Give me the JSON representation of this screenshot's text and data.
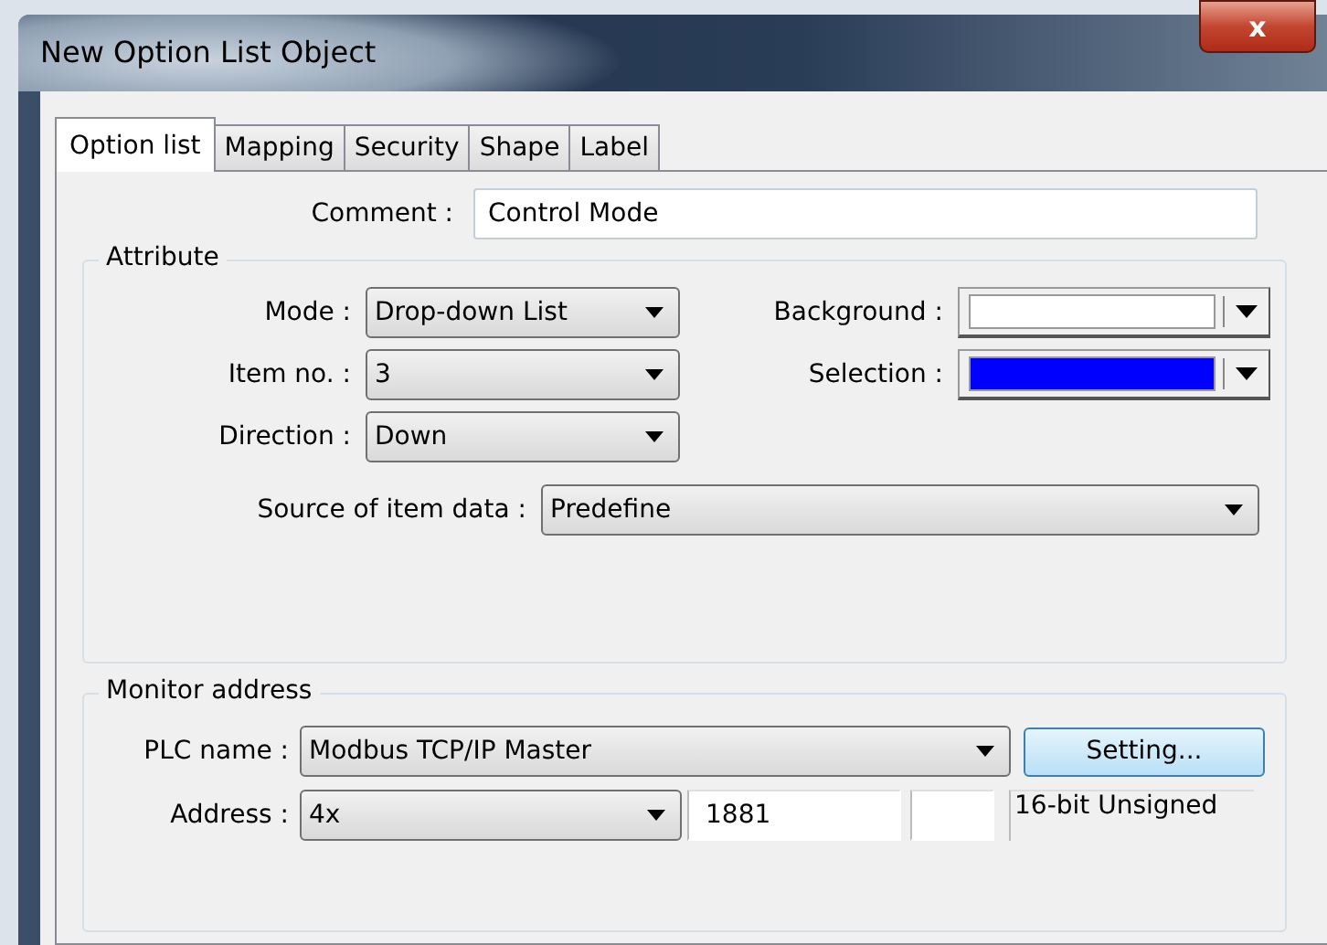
{
  "window": {
    "title": "New  Option List Object",
    "close": "x"
  },
  "tabs": [
    {
      "label": "Option list",
      "selected": true
    },
    {
      "label": "Mapping",
      "selected": false
    },
    {
      "label": "Security",
      "selected": false
    },
    {
      "label": "Shape",
      "selected": false
    },
    {
      "label": "Label",
      "selected": false
    }
  ],
  "comment": {
    "label": "Comment :",
    "value": "Control Mode"
  },
  "attribute": {
    "title": "Attribute",
    "fields": [
      {
        "label": "Mode :",
        "kind": "combo",
        "value": "Drop-down List"
      },
      {
        "label": "Background :",
        "kind": "color",
        "color": "#ffffff"
      },
      {
        "label": "Item no. :",
        "kind": "combo",
        "value": "3"
      },
      {
        "label": "Selection :",
        "kind": "color",
        "color": "#0000ff"
      },
      {
        "label": "Direction :",
        "kind": "combo",
        "value": "Down"
      }
    ],
    "source": {
      "label": "Source of item data :",
      "value": "Predefine"
    }
  },
  "monitor": {
    "title": "Monitor address",
    "plc": {
      "label": "PLC name :",
      "value": "Modbus TCP/IP Master"
    },
    "setting_button": "Setting...",
    "address": {
      "label": "Address :",
      "device": "4x",
      "number": "1881",
      "data_type": "16-bit Unsigned"
    }
  }
}
